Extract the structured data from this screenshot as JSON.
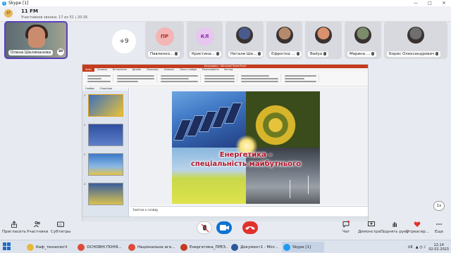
{
  "window": {
    "title": "Skype [1]",
    "controls": [
      "—",
      "□",
      "✕"
    ]
  },
  "call": {
    "initials": "1F",
    "name": "11 FM",
    "subtitle": "Участников звонка: 17 из 51 | 20:16"
  },
  "tiles": {
    "self": {
      "name": "Олена Шеляманова",
      "badge": "30"
    },
    "more": {
      "label": "+9"
    },
    "participants": [
      {
        "initials": "ПР",
        "name": "Павленко...",
        "color": "#f4b5b5",
        "text_color": "#b12b2b"
      },
      {
        "initials": "КЛ",
        "name": "Кристина...",
        "color": "#e7c6f0",
        "text_color": "#8b2ba8"
      },
      {
        "initials": "",
        "name": "Натали Ше...",
        "color": "#4a5a8a",
        "text_color": "#fff"
      },
      {
        "initials": "",
        "name": "Єфрогіна ...",
        "color": "#b58a6c",
        "text_color": "#fff"
      },
      {
        "initials": "",
        "name": "Badya",
        "color": "#d9906c",
        "text_color": "#fff"
      },
      {
        "initials": "",
        "name": "Марина ...",
        "color": "#7c8b6a",
        "text_color": "#fff"
      },
      {
        "initials": "",
        "name": "Борис Олександрович",
        "color": "#6f6f6f",
        "text_color": "#fff"
      }
    ]
  },
  "powerpoint": {
    "title": "Безумовно - Microsoft PowerPoint",
    "tabs": [
      "Файл",
      "Основна",
      "Вставлення",
      "Дизайн",
      "Переходи",
      "Анімація",
      "Показ слайдів",
      "Рецензування",
      "Вигляд"
    ],
    "left_tabs": [
      "Слайди",
      "Структура"
    ],
    "slide_numbers": [
      "1",
      "2",
      "3",
      "4"
    ],
    "slide_title": "Енергетика –\nспеціальність майбутнього",
    "notes": "Замітки к слайду"
  },
  "zoom": "1x",
  "controls": {
    "left": [
      {
        "label": "Пригласить",
        "icon": "share-icon"
      },
      {
        "label": "Участники",
        "icon": "people-icon"
      },
      {
        "label": "Субтитры",
        "icon": "captions-icon"
      }
    ],
    "right": [
      {
        "label": "Чат",
        "icon": "chat-icon"
      },
      {
        "label": "Демонстра...",
        "icon": "screen-share-icon"
      },
      {
        "label": "Поднять руку",
        "icon": "hand-icon"
      },
      {
        "label": "Отреагир...",
        "icon": "heart-icon"
      },
      {
        "label": "Еще",
        "icon": "more-icon"
      }
    ]
  },
  "taskbar": {
    "items": [
      {
        "label": "Каф_технології",
        "color": "#e7b93a",
        "icon": "folder-icon"
      },
      {
        "label": "ОСНОВНІ ПОНЯ...",
        "color": "#dd4b39",
        "icon": "chrome-icon"
      },
      {
        "label": "Національне аге...",
        "color": "#dd4b39",
        "icon": "chrome-icon"
      },
      {
        "label": "Енергетика_ПРЕЗ...",
        "color": "#c43b1d",
        "icon": "powerpoint-icon"
      },
      {
        "label": "Документ1 - Micr...",
        "color": "#2b579a",
        "icon": "word-icon"
      },
      {
        "label": "Skype [1]",
        "color": "#1d9bf0",
        "icon": "skype-icon"
      }
    ],
    "lang": "UK",
    "time": "12:14",
    "date": "02.02.2023"
  }
}
